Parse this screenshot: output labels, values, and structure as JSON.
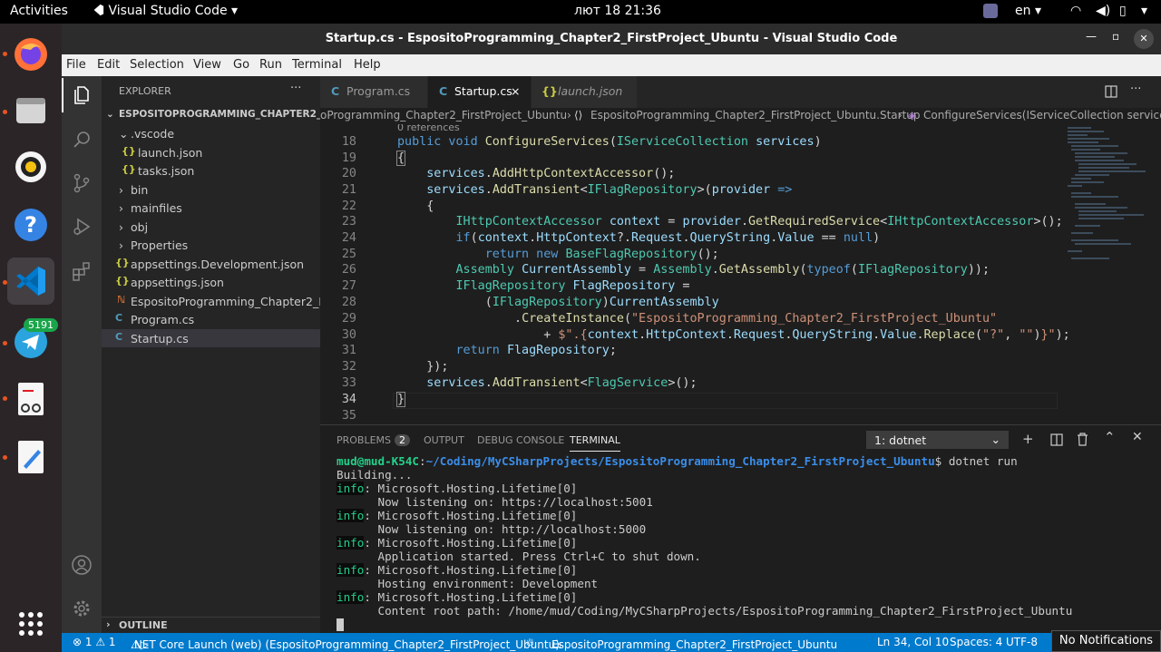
{
  "topbar": {
    "activities": "Activities",
    "app": "Visual Studio Code",
    "clock": "лют 18  21:36",
    "lang": "en"
  },
  "window": {
    "title": "Startup.cs - EspositoProgramming_Chapter2_FirstProject_Ubuntu - Visual Studio Code"
  },
  "menu": [
    "File",
    "Edit",
    "Selection",
    "View",
    "Go",
    "Run",
    "Terminal",
    "Help"
  ],
  "dock": {
    "telegram_badge": "5191"
  },
  "explorer": {
    "header": "EXPLORER",
    "root": "ESPOSITOPROGRAMMING_CHAPTER2_FIR...",
    "items": [
      {
        "label": ".vscode",
        "icon": "chevron-down"
      },
      {
        "label": "launch.json",
        "icon": "json"
      },
      {
        "label": "tasks.json",
        "icon": "json"
      },
      {
        "label": "bin",
        "icon": "chevron-right"
      },
      {
        "label": "mainfiles",
        "icon": "chevron-right"
      },
      {
        "label": "obj",
        "icon": "chevron-right"
      },
      {
        "label": "Properties",
        "icon": "chevron-right"
      },
      {
        "label": "appsettings.Development.json",
        "icon": "json"
      },
      {
        "label": "appsettings.json",
        "icon": "json"
      },
      {
        "label": "EspositoProgramming_Chapter2_Fi...",
        "icon": "rss"
      },
      {
        "label": "Program.cs",
        "icon": "csharp"
      },
      {
        "label": "Startup.cs",
        "icon": "csharp"
      }
    ],
    "outline": "OUTLINE"
  },
  "tabs": [
    {
      "label": "Program.cs"
    },
    {
      "label": "Startup.cs",
      "close": "×"
    },
    {
      "label": "launch.json"
    }
  ],
  "breadcrumb": {
    "project": "oProgramming_Chapter2_FirstProject_Ubuntu",
    "class": "EspositoProgramming_Chapter2_FirstProject_Ubuntu.Startup",
    "method": "ConfigureServices(IServiceCollection services)"
  },
  "editor": {
    "codelens": "0 references",
    "line_numbers": [
      "18",
      "19",
      "20",
      "21",
      "22",
      "23",
      "24",
      "25",
      "26",
      "27",
      "28",
      "29",
      "30",
      "31",
      "32",
      "33",
      "34",
      "35"
    ],
    "cursor_line": "34"
  },
  "panel": {
    "tabs": {
      "problems": "PROBLEMS",
      "problems_count": "2",
      "output": "OUTPUT",
      "debug": "DEBUG CONSOLE",
      "terminal": "TERMINAL"
    },
    "terminal_select": "1: dotnet",
    "terminal": {
      "user": "mud@mud-K54C",
      "cwd": "~/Coding/MyCSharpProjects/EspositoProgramming_Chapter2_FirstProject_Ubuntu",
      "command": "$ dotnet run",
      "building": "Building...",
      "info_tag": "info",
      "log": [
        {
          "head": ": Microsoft.Hosting.Lifetime[0]",
          "msg": "      Now listening on: https://localhost:5001"
        },
        {
          "head": ": Microsoft.Hosting.Lifetime[0]",
          "msg": "      Now listening on: http://localhost:5000"
        },
        {
          "head": ": Microsoft.Hosting.Lifetime[0]",
          "msg": "      Application started. Press Ctrl+C to shut down."
        },
        {
          "head": ": Microsoft.Hosting.Lifetime[0]",
          "msg": "      Hosting environment: Development"
        },
        {
          "head": ": Microsoft.Hosting.Lifetime[0]",
          "msg": "      Content root path: /home/mud/Coding/MyCSharpProjects/EspositoProgramming_Chapter2_FirstProject_Ubuntu"
        }
      ]
    }
  },
  "status": {
    "problems": "⊗ 1 ⚠ 1",
    "launch": ".NET Core Launch (web) (EspositoProgramming_Chapter2_FirstProject_Ubuntu)",
    "project": "EspositoProgramming_Chapter2_FirstProject_Ubuntu",
    "position": "Ln 34, Col 10",
    "spaces": "Spaces: 4",
    "encoding": "UTF-8",
    "notifications": "No Notifications"
  },
  "colors": {
    "accent": "#007acc",
    "dock_bg": "#2b2528",
    "ubuntu_orange": "#e95420"
  }
}
